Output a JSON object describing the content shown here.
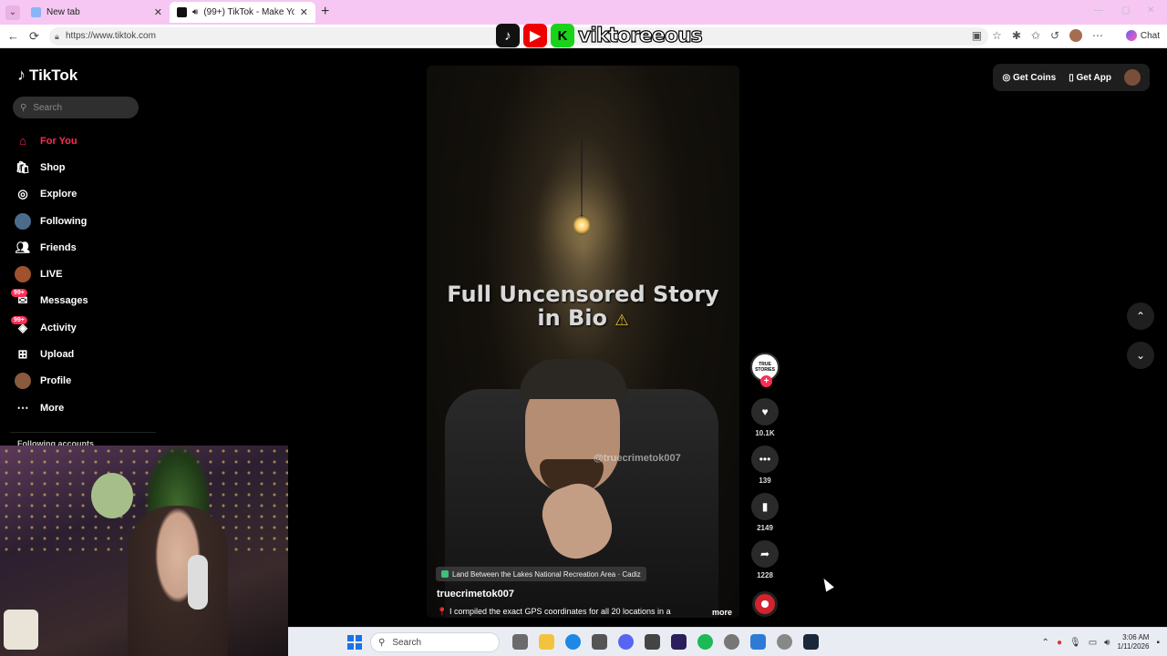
{
  "browser": {
    "tabs": [
      {
        "label": "New tab",
        "close": "✕"
      },
      {
        "label": "(99+) TikTok - Make Your Day",
        "close": "✕"
      }
    ],
    "new_tab": "+",
    "url": "https://www.tiktok.com",
    "chat_label": "Chat"
  },
  "overlay_logo": {
    "text": "viktoreeous"
  },
  "tiktok": {
    "logo_text": "TikTok",
    "search_placeholder": "Search",
    "nav": [
      {
        "label": "For You",
        "icon": "home-icon"
      },
      {
        "label": "Shop",
        "icon": "shop-icon"
      },
      {
        "label": "Explore",
        "icon": "compass-icon"
      },
      {
        "label": "Following",
        "icon": "following-avatar-icon"
      },
      {
        "label": "Friends",
        "icon": "friends-icon"
      },
      {
        "label": "LIVE",
        "icon": "live-icon"
      },
      {
        "label": "Messages",
        "icon": "messages-icon",
        "badge": "99+"
      },
      {
        "label": "Activity",
        "icon": "activity-icon",
        "badge": "99+"
      },
      {
        "label": "Upload",
        "icon": "upload-icon"
      },
      {
        "label": "Profile",
        "icon": "profile-icon"
      },
      {
        "label": "More",
        "icon": "more-icon"
      }
    ],
    "following_accounts_label": "Following accounts",
    "top_actions": {
      "coins": "Get Coins",
      "app": "Get App"
    },
    "video": {
      "caption_line1": "Full Uncensored Story",
      "caption_line2": "in Bio",
      "watermark": "@truecrimetok007",
      "location": "Land Between the Lakes National Recreation Area · Cadiz",
      "author": "truecrimetok007",
      "description": "I compiled the exact GPS coordinates for all 20 locations in a",
      "more": "more",
      "progress_fraction": 0.34
    },
    "creator_badge": "TRUE STORIES",
    "actions": {
      "likes": "10.1K",
      "comments": "139",
      "saves": "2149",
      "shares": "1228"
    }
  },
  "taskbar": {
    "search_label": "Search",
    "time": "3:06 AM",
    "date": "1/11/2026"
  },
  "colors": {
    "accent": "#fe2c55",
    "tab_bar": "#f6c7f2"
  }
}
